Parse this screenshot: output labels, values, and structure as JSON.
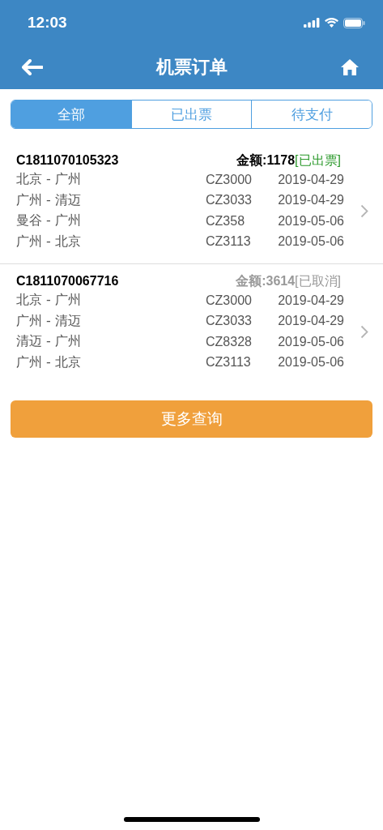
{
  "status_bar": {
    "time": "12:03"
  },
  "nav": {
    "title": "机票订单"
  },
  "tabs": [
    {
      "label": "全部",
      "selected": true
    },
    {
      "label": "已出票",
      "selected": false
    },
    {
      "label": "待支付",
      "selected": false
    }
  ],
  "orders": [
    {
      "number": "C1811070105323",
      "amount": "金额:1178",
      "status": "[已出票]",
      "kind": "issued",
      "flights": [
        {
          "route": "北京 - 广州",
          "flight": "CZ3000",
          "date": "2019-04-29"
        },
        {
          "route": "广州 - 清迈",
          "flight": "CZ3033",
          "date": "2019-04-29"
        },
        {
          "route": "曼谷 - 广州",
          "flight": "CZ358",
          "date": "2019-05-06"
        },
        {
          "route": "广州 - 北京",
          "flight": "CZ3113",
          "date": "2019-05-06"
        }
      ]
    },
    {
      "number": "C1811070067716",
      "amount": "金额:3614",
      "status": "[已取消]",
      "kind": "cancelled",
      "flights": [
        {
          "route": "北京 - 广州",
          "flight": "CZ3000",
          "date": "2019-04-29"
        },
        {
          "route": "广州 - 清迈",
          "flight": "CZ3033",
          "date": "2019-04-29"
        },
        {
          "route": "清迈 - 广州",
          "flight": "CZ8328",
          "date": "2019-05-06"
        },
        {
          "route": "广州 - 北京",
          "flight": "CZ3113",
          "date": "2019-05-06"
        }
      ]
    }
  ],
  "more_button": "更多查询"
}
